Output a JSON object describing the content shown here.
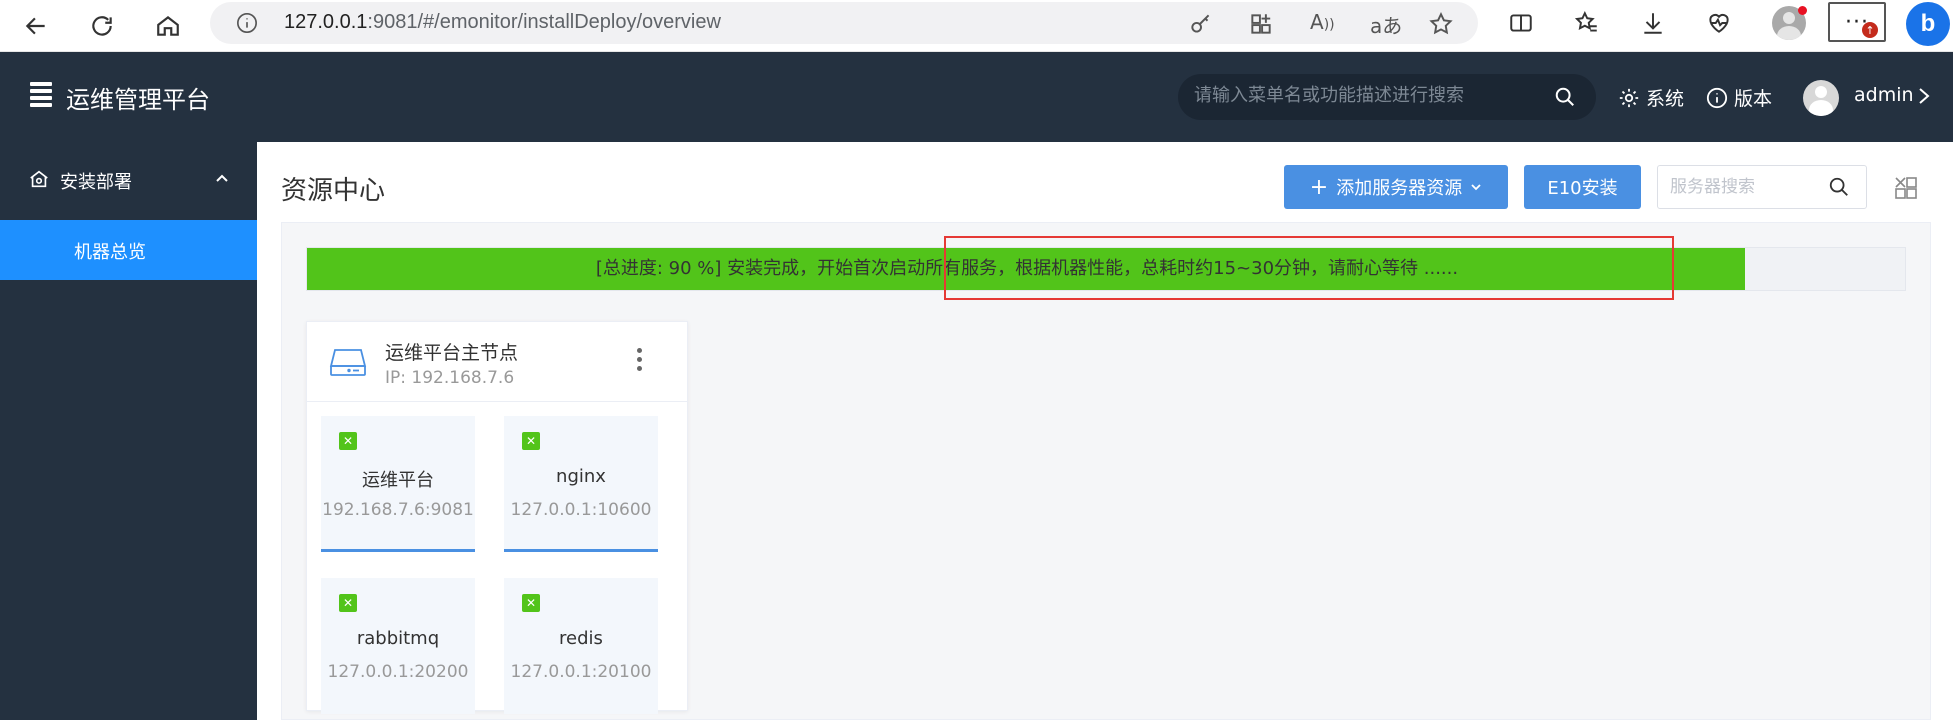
{
  "browser": {
    "url_host": "127.0.0.1",
    "url_rest": ":9081/#/emonitor/installDeploy/overview",
    "read_aloud_glyph": "A",
    "translate_glyph": "aあ",
    "more_glyph": "···",
    "notif_badge": "↑",
    "bing_glyph": "b"
  },
  "header": {
    "app_title": "运维管理平台",
    "search_placeholder": "请输入菜单名或功能描述进行搜索",
    "system_label": "系统",
    "version_label": "版本",
    "user_name": "admin"
  },
  "sidebar": {
    "group_label": "安装部署",
    "items": [
      {
        "label": "机器总览",
        "active": true
      }
    ]
  },
  "main": {
    "page_title": "资源中心",
    "add_button_label": "添加服务器资源",
    "add_button_plus": "+",
    "e10_button_label": "E10安装",
    "server_search_placeholder": "服务器搜索",
    "progress": {
      "percent": 90,
      "text": "[总进度: 90 %]   安装完成，开始首次启动所有服务，根据机器性能，总耗时约15~30分钟，请耐心等待 ......",
      "color": "#52c41a"
    },
    "card": {
      "title": "运维平台主节点",
      "ip": "IP: 192.168.7.6",
      "services": [
        {
          "name": "运维平台",
          "address": "192.168.7.6:9081"
        },
        {
          "name": "nginx",
          "address": "127.0.0.1:10600"
        },
        {
          "name": "rabbitmq",
          "address": "127.0.0.1:20200"
        },
        {
          "name": "redis",
          "address": "127.0.0.1:20100"
        }
      ]
    }
  },
  "colors": {
    "header_bg": "#243140",
    "accent": "#1e90ff",
    "button_blue": "#4a90e2",
    "progress_green": "#52c41a",
    "highlight_red": "#e53935"
  }
}
